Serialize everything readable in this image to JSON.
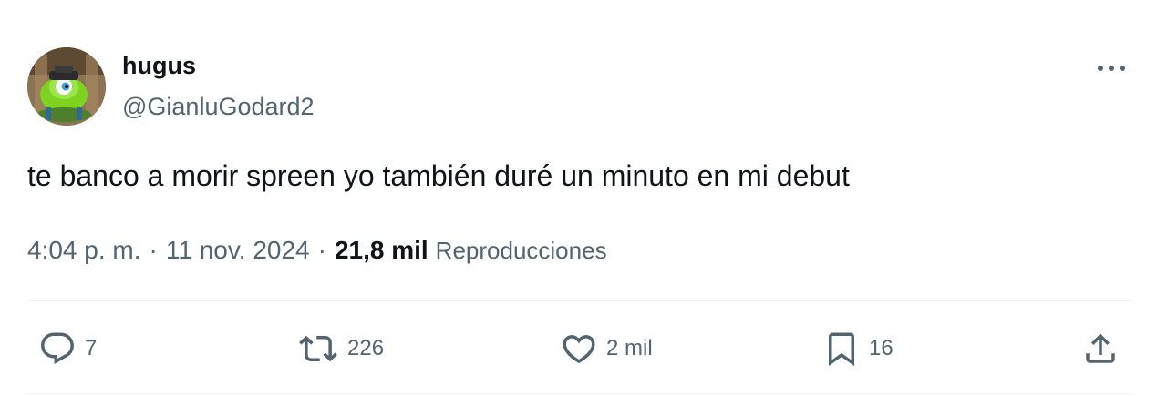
{
  "author": {
    "display_name": "hugus",
    "handle": "@GianluGodard2",
    "avatar_icon": "avatar-image"
  },
  "tweet": {
    "text": "te banco a morir spreen yo también duré un minuto en mi debut"
  },
  "meta": {
    "time": "4:04 p. m.",
    "separator": "·",
    "date": "11 nov. 2024",
    "views_count": "21,8 mil",
    "views_label": "Reproducciones"
  },
  "actions": {
    "reply_count": "7",
    "retweet_count": "226",
    "like_count": "2 mil",
    "bookmark_count": "16"
  },
  "colors": {
    "text_primary": "#0f1419",
    "text_secondary": "#536471",
    "divider": "#eff3f4",
    "background": "#ffffff"
  }
}
